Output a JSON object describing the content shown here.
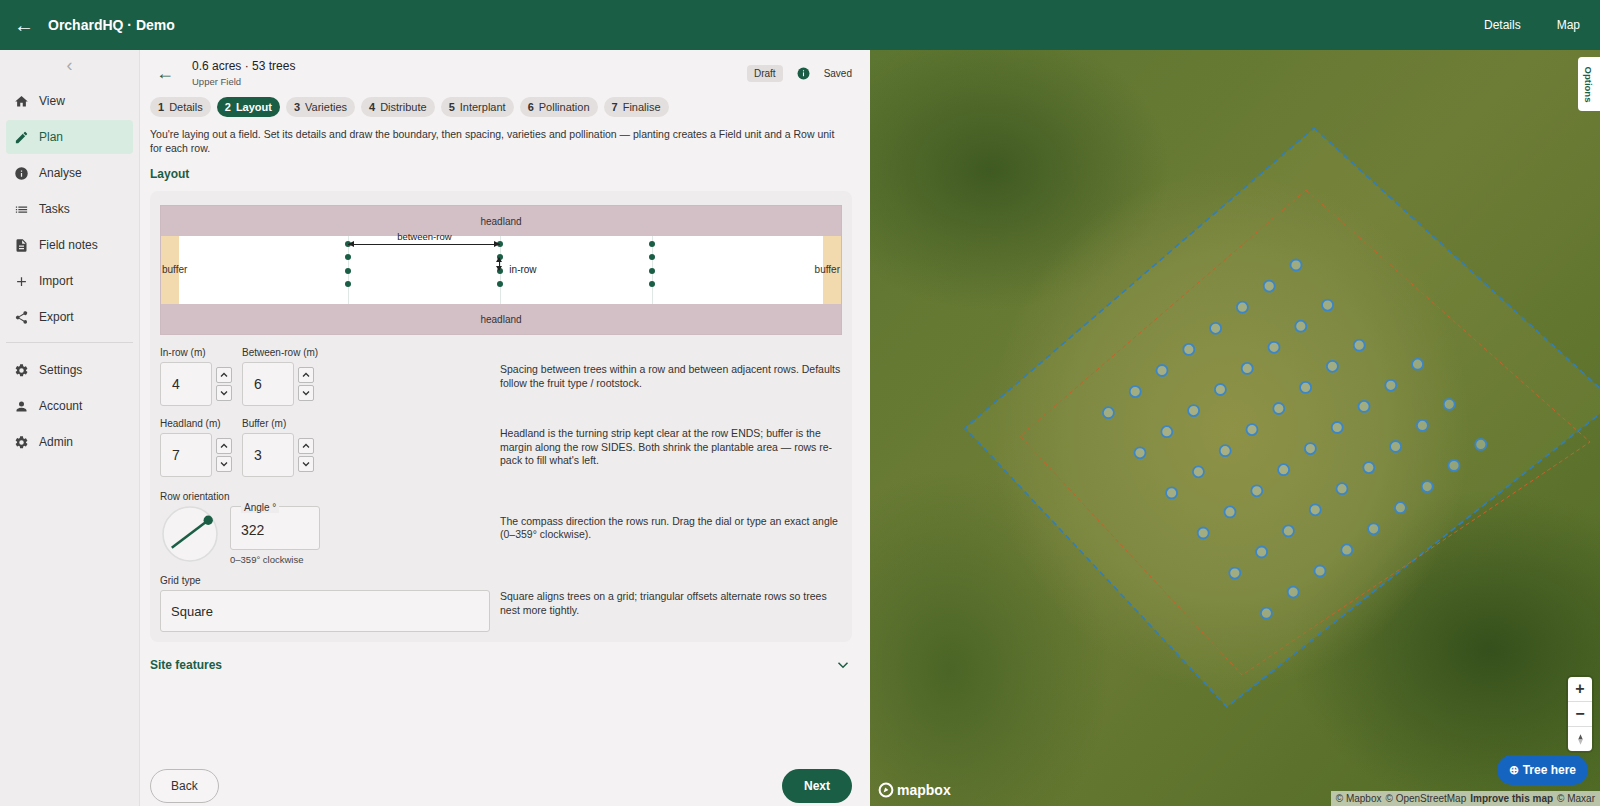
{
  "app": {
    "back_icon": "←",
    "title": "OrchardHQ · Demo",
    "nav": [
      "Details",
      "Map"
    ]
  },
  "sidebar": {
    "collapse": "‹",
    "groups": [
      [
        {
          "label": "View",
          "selected": false
        },
        {
          "label": "Plan",
          "selected": true
        },
        {
          "label": "Analyse",
          "selected": false
        },
        {
          "label": "Tasks",
          "selected": false
        },
        {
          "label": "Field notes",
          "selected": false
        },
        {
          "label": "Import",
          "selected": false
        },
        {
          "label": "Export",
          "selected": false
        }
      ],
      [
        {
          "label": "Settings",
          "selected": false
        },
        {
          "label": "Account",
          "selected": false
        },
        {
          "label": "Admin",
          "selected": false
        }
      ]
    ]
  },
  "header": {
    "back_icon": "←",
    "summary": "0.6 acres · 53 trees",
    "field": "Upper Field",
    "status": "Draft",
    "saved": "Saved"
  },
  "steps": [
    {
      "num": "1",
      "label": "Details",
      "selected": false
    },
    {
      "num": "2",
      "label": "Layout",
      "selected": true
    },
    {
      "num": "3",
      "label": "Varieties",
      "selected": false
    },
    {
      "num": "4",
      "label": "Distribute",
      "selected": false
    },
    {
      "num": "5",
      "label": "Interplant",
      "selected": false
    },
    {
      "num": "6",
      "label": "Pollination",
      "selected": false
    },
    {
      "num": "7",
      "label": "Finalise",
      "selected": false
    }
  ],
  "intro": "You're laying out a field. Set its details and draw the boundary, then spacing, varieties and pollination — planting creates a Field unit and a Row unit for each row.",
  "section": "Layout",
  "diagram": {
    "top": "headland",
    "bottom": "headland",
    "left": "buffer",
    "right": "buffer",
    "between": "between-row",
    "inrow": "in-row"
  },
  "field_rows": [
    {
      "fields": [
        {
          "label": "In-row (m)",
          "value": "4"
        },
        {
          "label": "Between-row (m)",
          "value": "6"
        }
      ],
      "help": "Spacing between trees within a row and between adjacent rows. Defaults follow the fruit type / rootstock."
    },
    {
      "fields": [
        {
          "label": "Headland (m)",
          "value": "7"
        },
        {
          "label": "Buffer (m)",
          "value": "3"
        }
      ],
      "help": "Headland is the turning strip kept clear at the row ENDS; buffer is the margin along the row SIDES. Both shrink the plantable area — rows re-pack to fill what's left."
    }
  ],
  "orientation": {
    "label": "Row orientation",
    "field_label": "Angle °",
    "value": "322",
    "hint": "0–359° clockwise",
    "dial_deg": 53,
    "help": "The compass direction the rows run. Drag the dial or type an exact angle (0–359° clockwise)."
  },
  "grid": {
    "label": "Grid type",
    "value": "Square",
    "help": "Square aligns trees on a grid; triangular offsets alternate rows so trees nest more tightly."
  },
  "site_features": {
    "label": "Site features",
    "expanded": false
  },
  "buttons": {
    "back": "Back",
    "next": "Next"
  },
  "map": {
    "options": "Options",
    "zoom": [
      "+",
      "−"
    ],
    "tree_button": {
      "icon": "⊕",
      "label": "Tree here"
    },
    "logo": "mapbox",
    "attribution": [
      {
        "text": "© Mapbox",
        "bold": false
      },
      {
        "text": "© OpenStreetMap",
        "bold": false
      },
      {
        "text": "Improve this map",
        "bold": true
      },
      {
        "text": "© Maxar",
        "bold": false
      }
    ]
  }
}
